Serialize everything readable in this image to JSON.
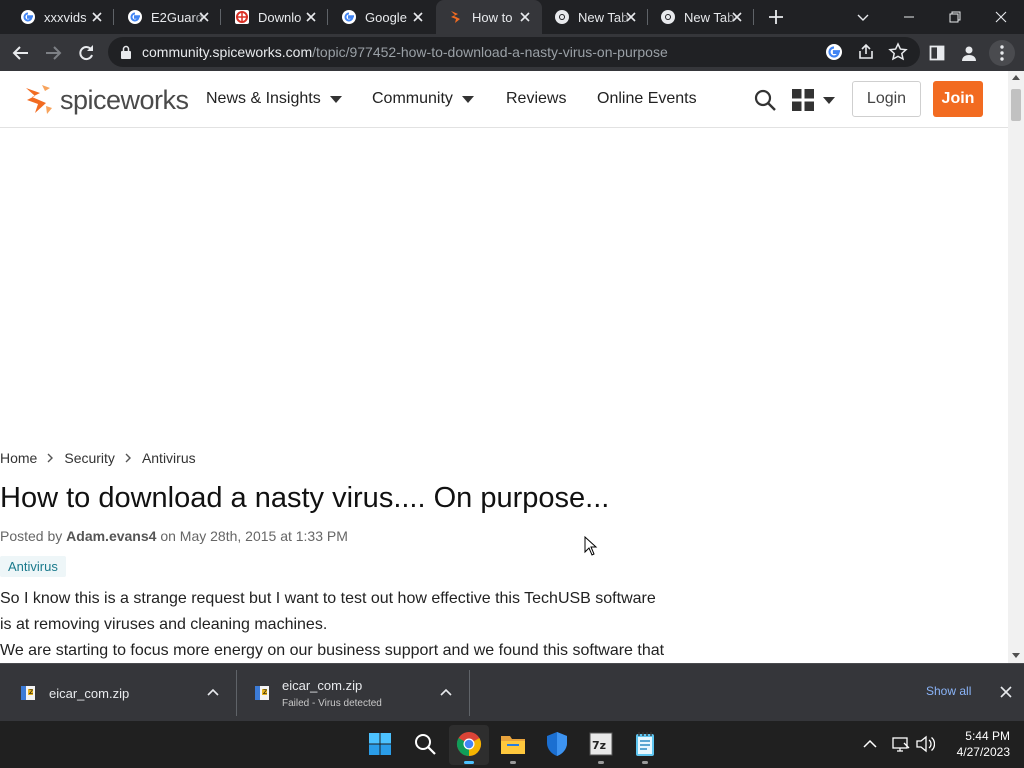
{
  "browser": {
    "tabs": [
      {
        "title": "xxxvids",
        "icon": "google-icon",
        "active": false
      },
      {
        "title": "E2Guard",
        "icon": "google-icon",
        "active": false
      },
      {
        "title": "Downlo",
        "icon": "download-site-icon",
        "active": false
      },
      {
        "title": "Google",
        "icon": "google-icon",
        "active": false
      },
      {
        "title": "How to",
        "icon": "spiceworks-icon",
        "active": true
      },
      {
        "title": "New Tab",
        "icon": "chrome-icon",
        "active": false
      },
      {
        "title": "New Tab",
        "icon": "chrome-icon",
        "active": false
      }
    ],
    "url_host": "community.spiceworks.com",
    "url_path": "/topic/977452-how-to-download-a-nasty-virus-on-purpose"
  },
  "site": {
    "logo_text": "spiceworks",
    "nav": [
      {
        "label": "News & Insights",
        "dropdown": true
      },
      {
        "label": "Community",
        "dropdown": true
      },
      {
        "label": "Reviews",
        "dropdown": false
      },
      {
        "label": "Online Events",
        "dropdown": false
      }
    ],
    "login_label": "Login",
    "join_label": "Join",
    "accent_color": "#f26b21"
  },
  "breadcrumb": [
    "Home",
    "Security",
    "Antivirus"
  ],
  "post": {
    "title": "How to download a nasty virus.... On purpose...",
    "posted_by_prefix": "Posted by ",
    "author": "Adam.evans4",
    "date_text": " on May 28th, 2015 at 1:33 PM",
    "tag": "Antivirus",
    "body_lines": [
      "So I know this is a strange request but I want to test out how effective this TechUSB software",
      "is at removing viruses and cleaning machines.",
      "We are starting to focus more energy on our business support and we found this software that"
    ]
  },
  "downloads": {
    "items": [
      {
        "filename": "eicar_com.zip",
        "status": ""
      },
      {
        "filename": "eicar_com.zip",
        "status": "Failed - Virus detected"
      }
    ],
    "show_all_label": "Show all"
  },
  "taskbar": {
    "time": "5:44 PM",
    "date": "4/27/2023"
  }
}
